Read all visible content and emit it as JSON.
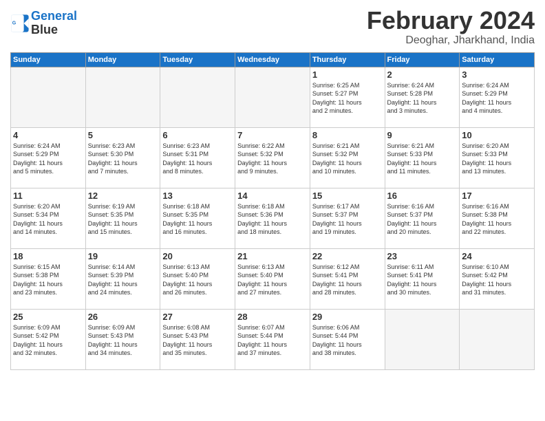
{
  "logo": {
    "line1": "General",
    "line2": "Blue"
  },
  "title": "February 2024",
  "subtitle": "Deoghar, Jharkhand, India",
  "days_header": [
    "Sunday",
    "Monday",
    "Tuesday",
    "Wednesday",
    "Thursday",
    "Friday",
    "Saturday"
  ],
  "weeks": [
    [
      {
        "day": "",
        "info": ""
      },
      {
        "day": "",
        "info": ""
      },
      {
        "day": "",
        "info": ""
      },
      {
        "day": "",
        "info": ""
      },
      {
        "day": "1",
        "info": "Sunrise: 6:25 AM\nSunset: 5:27 PM\nDaylight: 11 hours\nand 2 minutes."
      },
      {
        "day": "2",
        "info": "Sunrise: 6:24 AM\nSunset: 5:28 PM\nDaylight: 11 hours\nand 3 minutes."
      },
      {
        "day": "3",
        "info": "Sunrise: 6:24 AM\nSunset: 5:29 PM\nDaylight: 11 hours\nand 4 minutes."
      }
    ],
    [
      {
        "day": "4",
        "info": "Sunrise: 6:24 AM\nSunset: 5:29 PM\nDaylight: 11 hours\nand 5 minutes."
      },
      {
        "day": "5",
        "info": "Sunrise: 6:23 AM\nSunset: 5:30 PM\nDaylight: 11 hours\nand 7 minutes."
      },
      {
        "day": "6",
        "info": "Sunrise: 6:23 AM\nSunset: 5:31 PM\nDaylight: 11 hours\nand 8 minutes."
      },
      {
        "day": "7",
        "info": "Sunrise: 6:22 AM\nSunset: 5:32 PM\nDaylight: 11 hours\nand 9 minutes."
      },
      {
        "day": "8",
        "info": "Sunrise: 6:21 AM\nSunset: 5:32 PM\nDaylight: 11 hours\nand 10 minutes."
      },
      {
        "day": "9",
        "info": "Sunrise: 6:21 AM\nSunset: 5:33 PM\nDaylight: 11 hours\nand 11 minutes."
      },
      {
        "day": "10",
        "info": "Sunrise: 6:20 AM\nSunset: 5:33 PM\nDaylight: 11 hours\nand 13 minutes."
      }
    ],
    [
      {
        "day": "11",
        "info": "Sunrise: 6:20 AM\nSunset: 5:34 PM\nDaylight: 11 hours\nand 14 minutes."
      },
      {
        "day": "12",
        "info": "Sunrise: 6:19 AM\nSunset: 5:35 PM\nDaylight: 11 hours\nand 15 minutes."
      },
      {
        "day": "13",
        "info": "Sunrise: 6:18 AM\nSunset: 5:35 PM\nDaylight: 11 hours\nand 16 minutes."
      },
      {
        "day": "14",
        "info": "Sunrise: 6:18 AM\nSunset: 5:36 PM\nDaylight: 11 hours\nand 18 minutes."
      },
      {
        "day": "15",
        "info": "Sunrise: 6:17 AM\nSunset: 5:37 PM\nDaylight: 11 hours\nand 19 minutes."
      },
      {
        "day": "16",
        "info": "Sunrise: 6:16 AM\nSunset: 5:37 PM\nDaylight: 11 hours\nand 20 minutes."
      },
      {
        "day": "17",
        "info": "Sunrise: 6:16 AM\nSunset: 5:38 PM\nDaylight: 11 hours\nand 22 minutes."
      }
    ],
    [
      {
        "day": "18",
        "info": "Sunrise: 6:15 AM\nSunset: 5:38 PM\nDaylight: 11 hours\nand 23 minutes."
      },
      {
        "day": "19",
        "info": "Sunrise: 6:14 AM\nSunset: 5:39 PM\nDaylight: 11 hours\nand 24 minutes."
      },
      {
        "day": "20",
        "info": "Sunrise: 6:13 AM\nSunset: 5:40 PM\nDaylight: 11 hours\nand 26 minutes."
      },
      {
        "day": "21",
        "info": "Sunrise: 6:13 AM\nSunset: 5:40 PM\nDaylight: 11 hours\nand 27 minutes."
      },
      {
        "day": "22",
        "info": "Sunrise: 6:12 AM\nSunset: 5:41 PM\nDaylight: 11 hours\nand 28 minutes."
      },
      {
        "day": "23",
        "info": "Sunrise: 6:11 AM\nSunset: 5:41 PM\nDaylight: 11 hours\nand 30 minutes."
      },
      {
        "day": "24",
        "info": "Sunrise: 6:10 AM\nSunset: 5:42 PM\nDaylight: 11 hours\nand 31 minutes."
      }
    ],
    [
      {
        "day": "25",
        "info": "Sunrise: 6:09 AM\nSunset: 5:42 PM\nDaylight: 11 hours\nand 32 minutes."
      },
      {
        "day": "26",
        "info": "Sunrise: 6:09 AM\nSunset: 5:43 PM\nDaylight: 11 hours\nand 34 minutes."
      },
      {
        "day": "27",
        "info": "Sunrise: 6:08 AM\nSunset: 5:43 PM\nDaylight: 11 hours\nand 35 minutes."
      },
      {
        "day": "28",
        "info": "Sunrise: 6:07 AM\nSunset: 5:44 PM\nDaylight: 11 hours\nand 37 minutes."
      },
      {
        "day": "29",
        "info": "Sunrise: 6:06 AM\nSunset: 5:44 PM\nDaylight: 11 hours\nand 38 minutes."
      },
      {
        "day": "",
        "info": ""
      },
      {
        "day": "",
        "info": ""
      }
    ]
  ]
}
